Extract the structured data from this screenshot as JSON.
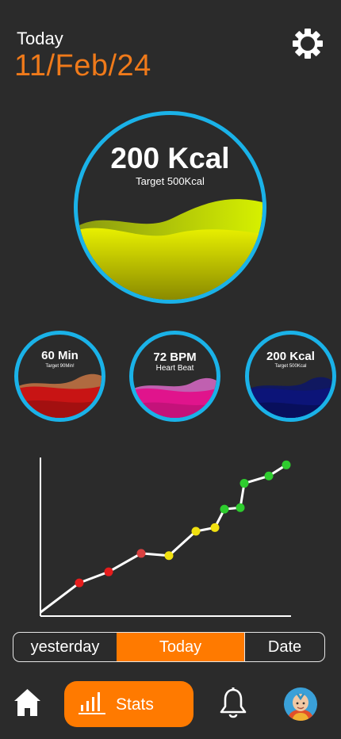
{
  "header": {
    "today_label": "Today",
    "date": "11/Feb/24"
  },
  "main_ring": {
    "value": "200 Kcal",
    "target": "Target 500Kcal"
  },
  "mini_rings": [
    {
      "value": "60 Min",
      "sub": "Target 90Min!"
    },
    {
      "value": "72 BPM",
      "sub": "Heart Beat"
    },
    {
      "value": "200 Kcal",
      "sub": "Target 500Kcal"
    }
  ],
  "chart_data": {
    "type": "line",
    "xlabel": "",
    "ylabel": "",
    "series": [
      {
        "x": [
          0,
          1,
          2,
          3,
          4,
          5,
          6,
          7,
          8,
          9,
          10,
          11
        ],
        "values": [
          0.5,
          4.5,
          6,
          8.5,
          8.2,
          11.5,
          12,
          14.5,
          14.7,
          18,
          19,
          20.5
        ],
        "colors": [
          "#e61c1c",
          "#e61c1c",
          "#d94040",
          "#f0e010",
          "#f0e010",
          "#f0e010",
          "#2ecc2e",
          "#2ecc2e",
          "#2ecc2e",
          "#2ecc2e",
          "#2ecc2e"
        ]
      }
    ],
    "ylim": [
      0,
      21.5
    ]
  },
  "segment": {
    "yesterday": "yesterday",
    "today": "Today",
    "date": "Date",
    "selected": "Today"
  },
  "nav": {
    "stats_label": "Stats"
  },
  "colors": {
    "accent": "#ff7a00",
    "ring": "#1ab2e8",
    "background": "#2b2b2b"
  },
  "icons": {
    "settings": "gear-icon",
    "home": "home-icon",
    "stats": "bar-chart-icon",
    "notifications": "bell-icon",
    "profile": "avatar"
  }
}
